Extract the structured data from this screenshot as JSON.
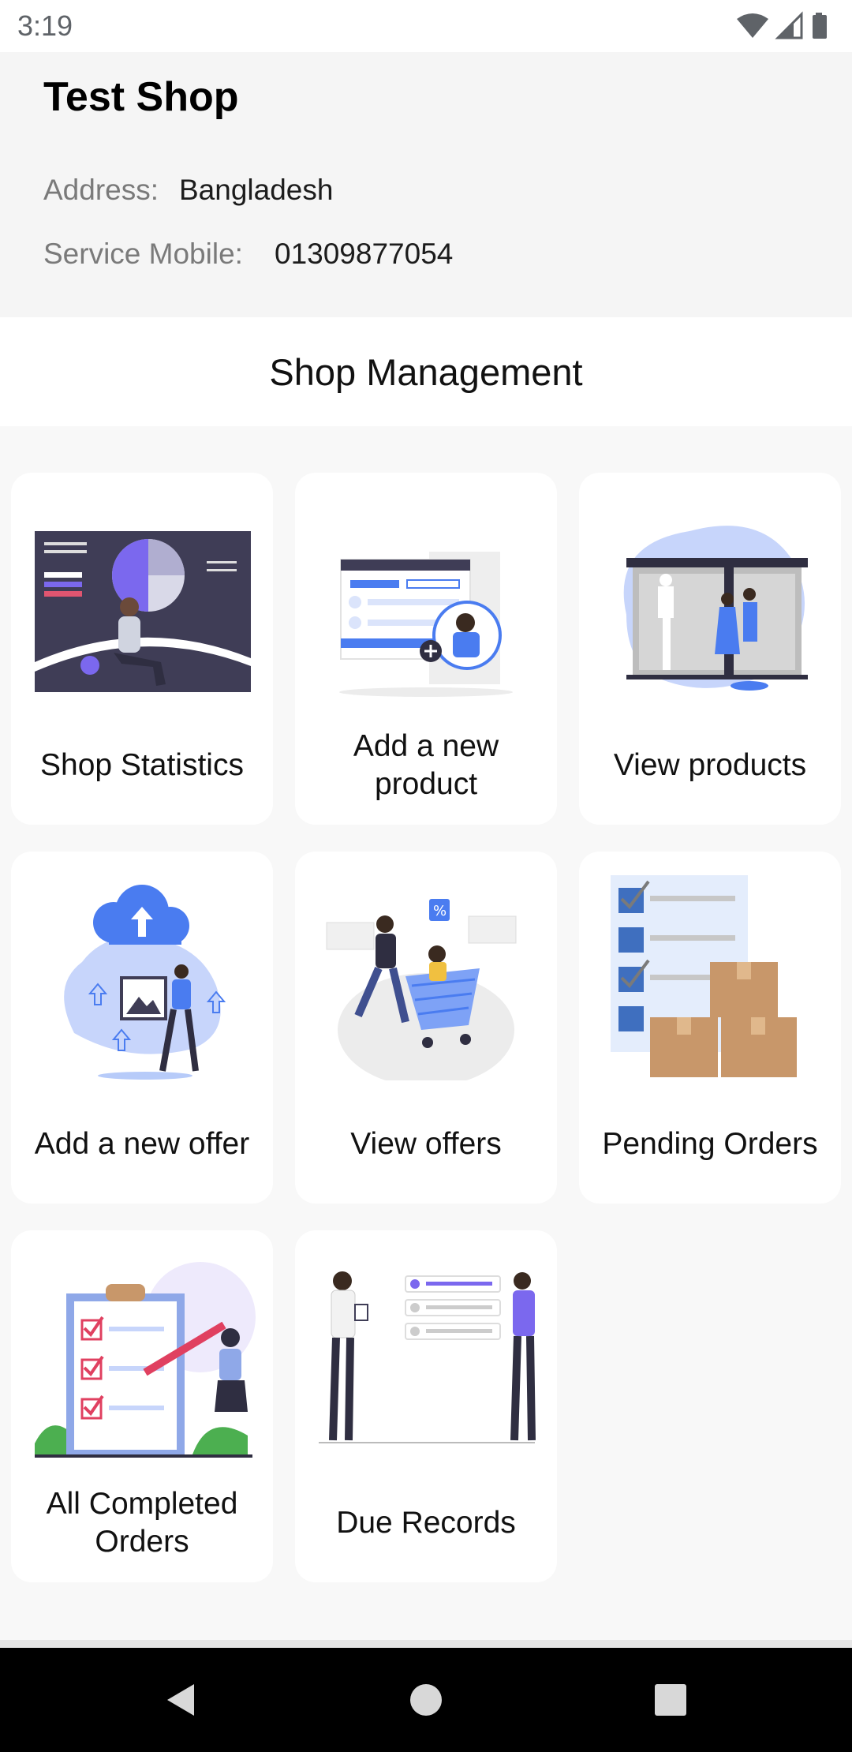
{
  "status_bar": {
    "time": "3:19",
    "icons": [
      "wifi-icon",
      "signal-icon",
      "battery-icon"
    ]
  },
  "shop": {
    "name": "Test Shop",
    "address_label": "Address:",
    "address_value": "Bangladesh",
    "mobile_label": "Service Mobile:",
    "mobile_value": "01309877054"
  },
  "section": {
    "title": "Shop Management"
  },
  "cards": [
    {
      "label": "Shop Statistics",
      "icon": "statistics-illustration"
    },
    {
      "label": "Add a new product",
      "icon": "add-product-illustration"
    },
    {
      "label": "View products",
      "icon": "storefront-illustration"
    },
    {
      "label": "Add a new offer",
      "icon": "upload-cloud-illustration"
    },
    {
      "label": "View offers",
      "icon": "shopping-cart-illustration"
    },
    {
      "label": "Pending Orders",
      "icon": "checklist-boxes-illustration"
    },
    {
      "label": "All Completed Orders",
      "icon": "clipboard-checklist-illustration"
    },
    {
      "label": "Due Records",
      "icon": "records-board-illustration"
    }
  ],
  "nav": {
    "buttons": [
      "back-icon",
      "home-icon",
      "recents-icon"
    ]
  },
  "colors": {
    "accent_blue": "#4a7cf0",
    "accent_purple": "#7b68ee",
    "dark_panel": "#3f3d56",
    "background": "#f8f8f8",
    "card": "#ffffff"
  }
}
